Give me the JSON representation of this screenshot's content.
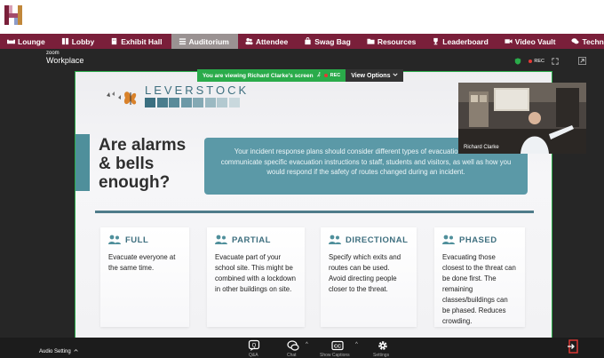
{
  "nav": {
    "items": [
      {
        "label": "Lounge",
        "icon": "couch-icon"
      },
      {
        "label": "Lobby",
        "icon": "book-icon"
      },
      {
        "label": "Exhibit Hall",
        "icon": "building-icon"
      },
      {
        "label": "Auditorium",
        "icon": "list-icon",
        "active": true
      },
      {
        "label": "Attendee",
        "icon": "users-icon"
      },
      {
        "label": "Swag Bag",
        "icon": "bag-icon"
      },
      {
        "label": "Resources",
        "icon": "folder-icon"
      },
      {
        "label": "Leaderboard",
        "icon": "trophy-icon"
      },
      {
        "label": "Video Vault",
        "icon": "video-icon"
      },
      {
        "label": "Technical",
        "icon": "chat-icon"
      }
    ]
  },
  "zoom": {
    "logo_top": "zoom",
    "logo_bottom": "Workplace",
    "rec_label": "REC",
    "viewing_text": "You are viewing  Richard Clarke's screen",
    "viewing_rec": "REC",
    "view_options_label": "View Options",
    "participant_name": "Richard Clarke",
    "audio_setting_label": "Audio Setting",
    "toolbar_labels": [
      "Q&A",
      "Chat",
      "Show Captions",
      "Settings"
    ]
  },
  "slide": {
    "brand_name": "LEVERSTOCK",
    "headline": "Are alarms & bells enough?",
    "callout": "Your incident response plans should consider different types of evacuation and how to communicate specific evacuation instructions to staff, students and visitors, as well as how you would respond if the safety of routes changed during an incident.",
    "cards": [
      {
        "title": "FULL",
        "body": "Evacuate everyone at the same time."
      },
      {
        "title": "PARTIAL",
        "body": "Evacuate part of your school site. This might be combined with a lockdown in other buildings on site."
      },
      {
        "title": "DIRECTIONAL",
        "body": "Specify which exits and routes can be used.\nAvoid directing people closer to the threat."
      },
      {
        "title": "PHASED",
        "body": "Evacuating those closest to the threat can be done first. The remaining classes/buildings can be phased. Reduces crowding."
      }
    ]
  },
  "colors": {
    "nav_bg": "#7a1f3a",
    "nav_active": "#9a9292",
    "zoom_bg": "#262626",
    "share_green": "#2aab4a",
    "slide_teal": "#5b99a7",
    "brand_teal": "#3e6f7f"
  }
}
